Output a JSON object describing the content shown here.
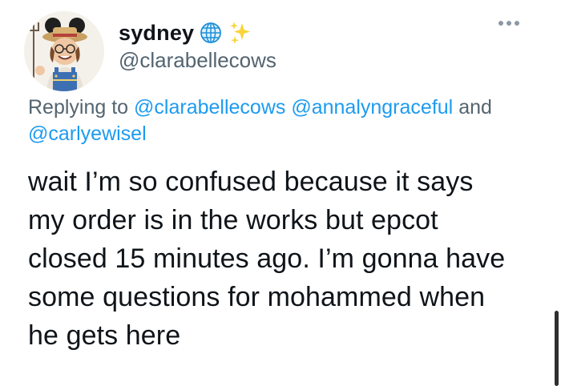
{
  "author": {
    "display_name": "sydney",
    "handle": "@clarabellecows",
    "name_emojis": [
      "globe-icon",
      "sparkles-icon"
    ]
  },
  "reply": {
    "prefix": "Replying to",
    "mention_1": "@clarabellecows",
    "mention_2": "@annalyngraceful",
    "connector": "and",
    "mention_3": "@carlyewisel"
  },
  "tweet": {
    "lines": [
      "wait I’m so confused because it says",
      "my order is in the works but epcot",
      "closed 15 minutes ago. I’m gonna have",
      "some questions for mohammed when",
      "he gets here"
    ]
  },
  "colors": {
    "accent": "#1d9bf0",
    "muted": "#536471",
    "text": "#0f1419"
  }
}
